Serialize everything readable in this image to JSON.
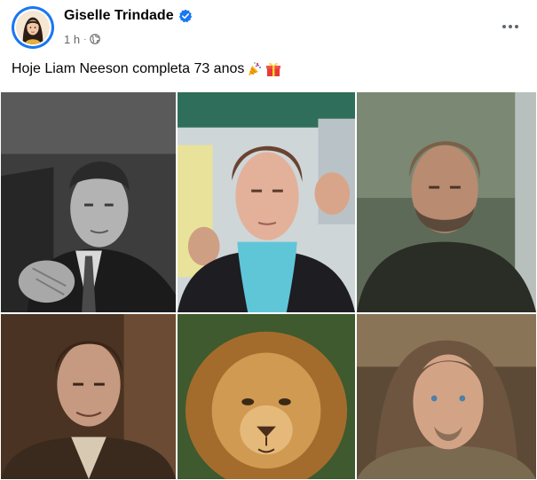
{
  "post": {
    "author_name": "Giselle Trindade",
    "time": "1 h",
    "separator": "·",
    "text": "Hoje Liam Neeson completa 73 anos",
    "icons": {
      "verified": "verified-badge-icon",
      "audience": "globe-icon",
      "more": "more-options-icon",
      "emoji_1": "party-popper-icon",
      "emoji_2": "gift-icon"
    },
    "colors": {
      "accent": "#1877f2",
      "meta_text": "#65676b"
    }
  },
  "photos": [
    {
      "description_icon": "photo-black-and-white-man"
    },
    {
      "description_icon": "photo-man-blue-turtleneck"
    },
    {
      "description_icon": "photo-bearded-warrior"
    },
    {
      "description_icon": "photo-man-brown-suit"
    },
    {
      "description_icon": "photo-lion"
    },
    {
      "description_icon": "photo-long-haired-jedi"
    }
  ]
}
